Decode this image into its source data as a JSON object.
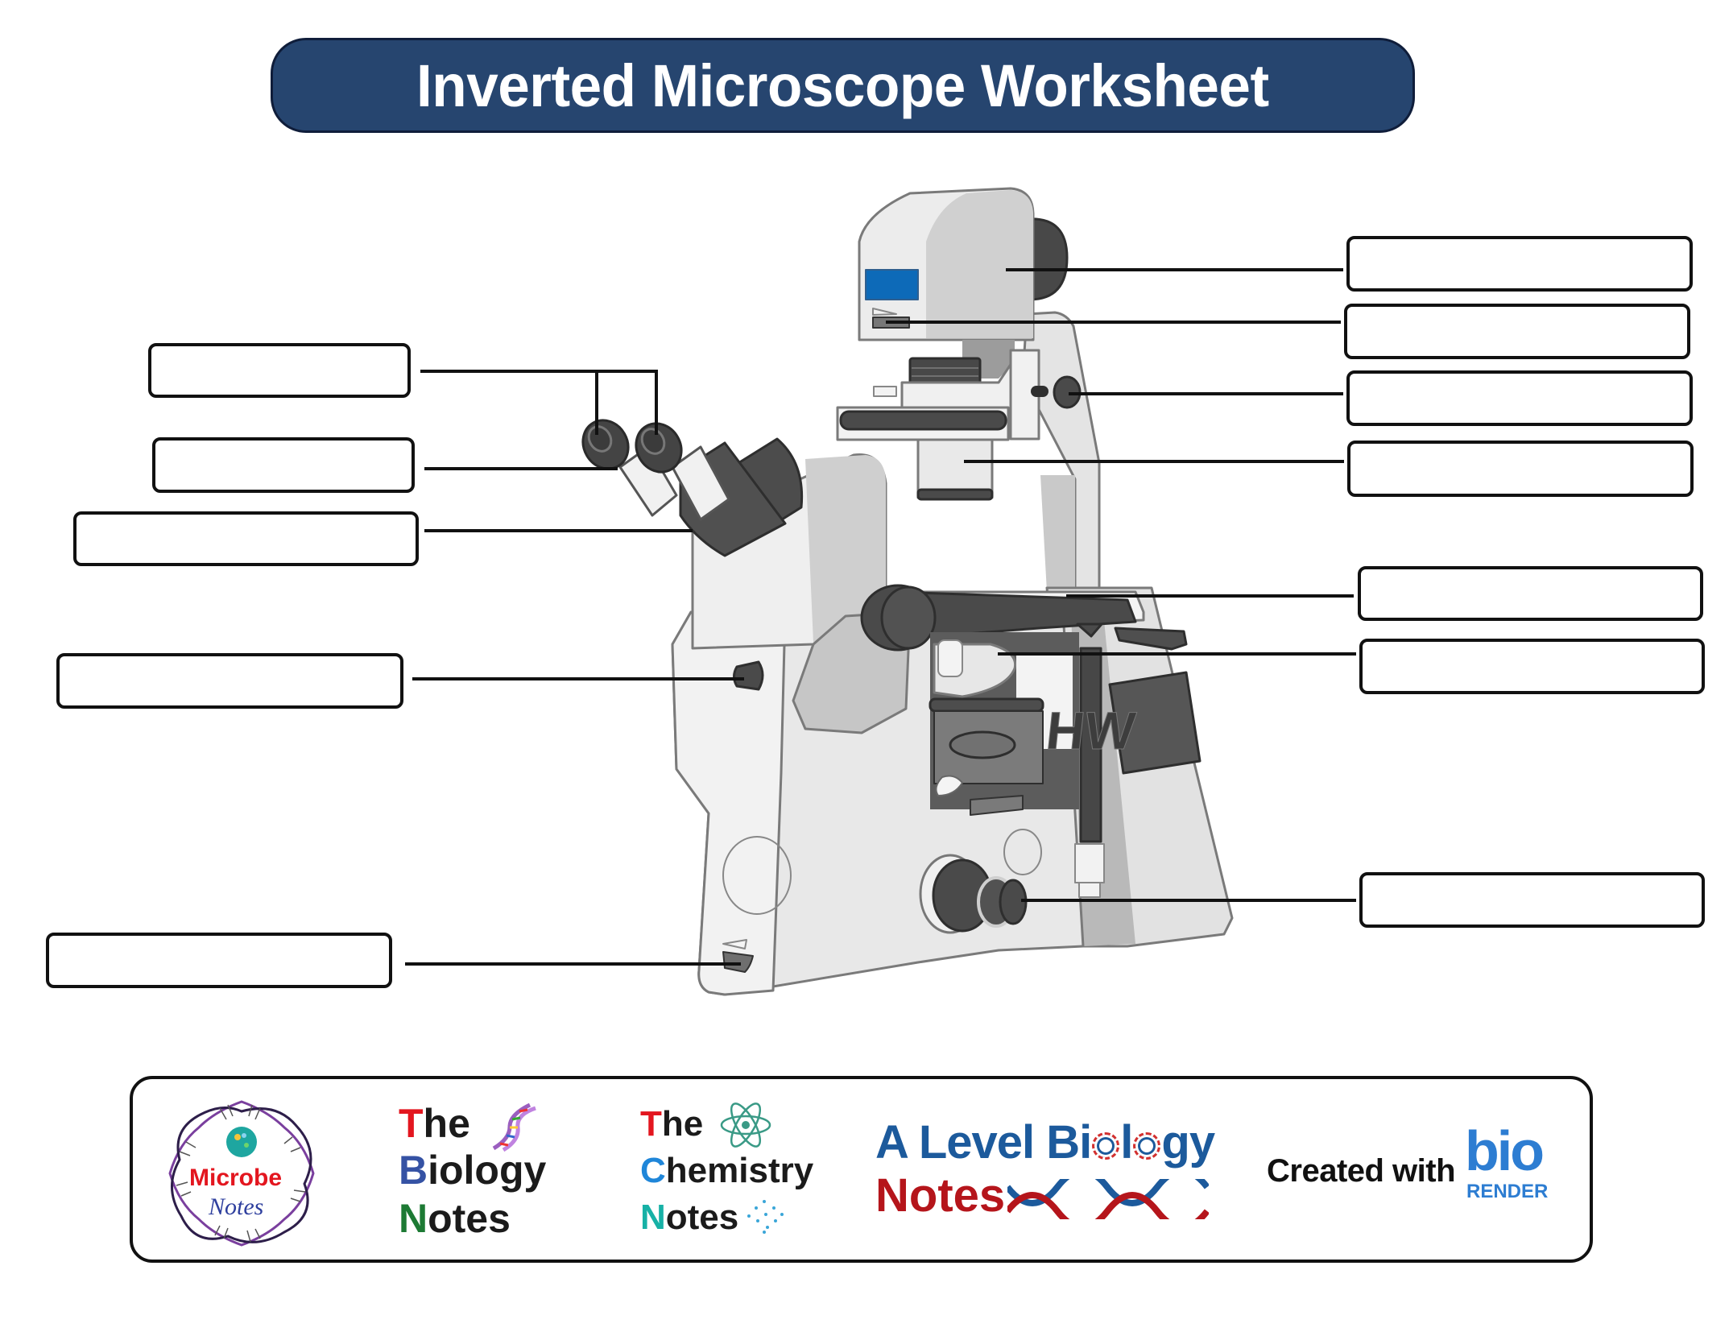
{
  "page": {
    "title": "Inverted Microscope Worksheet",
    "colors": {
      "title_bar": "#26456f",
      "title_text": "#ffffff",
      "label_border": "#111111",
      "microscope_body": "#e6e6e6",
      "microscope_dark": "#4a4a4a",
      "screen_blue": "#0d6ab8"
    }
  },
  "diagram": {
    "subject": "inverted microscope",
    "left_labels": [
      {
        "id": "L1",
        "target": "eyepieces (two leader lines)",
        "answer": ""
      },
      {
        "id": "L2",
        "target": "eyepiece tube",
        "answer": ""
      },
      {
        "id": "L3",
        "target": "binocular head",
        "answer": ""
      },
      {
        "id": "L4",
        "target": "side knob",
        "answer": ""
      },
      {
        "id": "L5",
        "target": "base switch",
        "answer": ""
      }
    ],
    "right_labels": [
      {
        "id": "R1",
        "target": "lamp housing",
        "answer": ""
      },
      {
        "id": "R2",
        "target": "lamp slider / control",
        "answer": ""
      },
      {
        "id": "R3",
        "target": "condenser adjustment knob",
        "answer": ""
      },
      {
        "id": "R4",
        "target": "condenser",
        "answer": ""
      },
      {
        "id": "R5",
        "target": "stage",
        "answer": ""
      },
      {
        "id": "R6",
        "target": "objective turret",
        "answer": ""
      },
      {
        "id": "R7",
        "target": "focus knob",
        "answer": ""
      }
    ]
  },
  "footer": {
    "logos": [
      {
        "name": "Microbe Notes",
        "line1": "Microbe",
        "line2": "Notes",
        "icon": "dna-ring-icon"
      },
      {
        "name": "The Biology Notes",
        "lines": [
          {
            "cap": "T",
            "rest": "he"
          },
          {
            "cap": "B",
            "rest": "iology"
          },
          {
            "cap": "N",
            "rest": "otes"
          }
        ],
        "icon": "dna-icon"
      },
      {
        "name": "The Chemistry Notes",
        "lines": [
          {
            "cap": "T",
            "rest": "he"
          },
          {
            "cap": "C",
            "rest": "hemistry"
          },
          {
            "cap": "N",
            "rest": "otes"
          }
        ],
        "icon": "atom-icon"
      },
      {
        "name": "A Level Biology Notes",
        "line1_a": "A Level Bi",
        "line1_b": "l",
        "line1_c": "gy",
        "line2": "Notes",
        "icon": "dna-helix-icon"
      },
      {
        "name": "BioRender",
        "prefix": "Created with",
        "brand_top": "bio",
        "brand_bottom": "RENDER"
      }
    ]
  }
}
